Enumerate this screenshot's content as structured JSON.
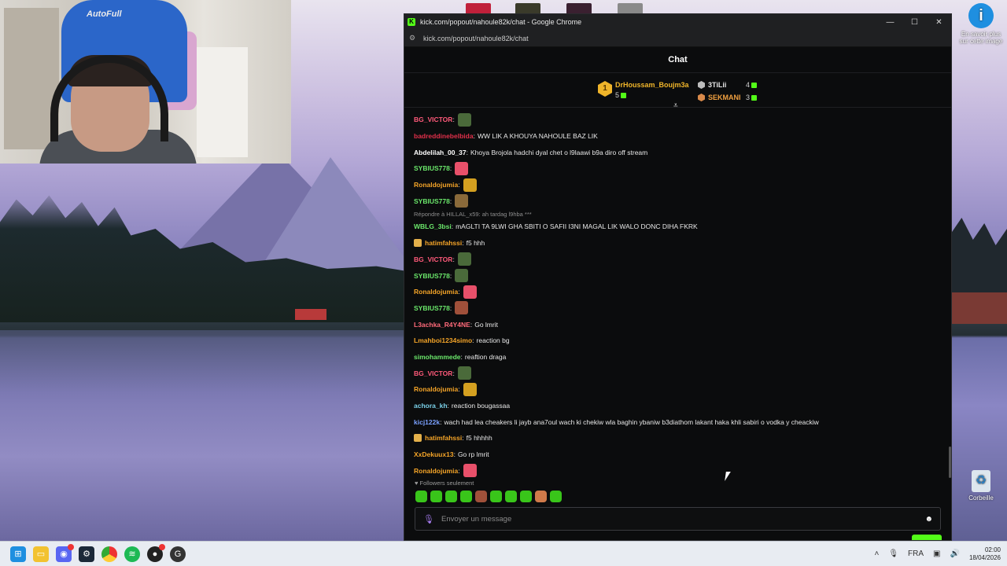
{
  "window": {
    "title": "kick.com/popout/nahoule82k/chat - Google Chrome",
    "url": "kick.com/popout/nahoule82k/chat"
  },
  "chat": {
    "header": "Chat",
    "top_gifters": [
      {
        "rank": "1",
        "name": "DrHoussam_Boujm3a",
        "count": "5"
      },
      {
        "name": "3TiLii",
        "count": "4"
      },
      {
        "name": "SEKMANI",
        "count": "3"
      }
    ],
    "messages": [
      {
        "user": "BG_VICTOR",
        "user_color": "#ff5a7a",
        "text": "",
        "emote_color": "#4a6a3a"
      },
      {
        "user": "badreddinebelbida",
        "user_color": "#e0304a",
        "text": "WW LIK A KHOUYA NAHOULE BAZ LIK"
      },
      {
        "user": "Abdelilah_00_37",
        "user_color": "#ffffff",
        "text": "Khoya Brojola hadchi dyal chet o l9laawi b9a diro off stream"
      },
      {
        "user": "SYBIUS778",
        "user_color": "#6be86b",
        "text": "",
        "emote_color": "#e8506a"
      },
      {
        "user": "Ronaldojumia",
        "user_color": "#f4a428",
        "text": "",
        "emote_color": "#d4a020"
      },
      {
        "user": "SYBIUS778",
        "user_color": "#6be86b",
        "text": "",
        "emote_color": "#8a6a3a"
      },
      {
        "user": "WBLG_3bsi",
        "user_color": "#6be86b",
        "text": "mAGLTI TA 9LWI GHA SBITI O SAFII I3NI MAGAL LIK WALO DONC DIHA FKRK",
        "reply": "Répondre à HILLAL_x59: ah tardag l9hba ***"
      },
      {
        "user": "hatimfahssi",
        "user_color": "#f4a428",
        "text": "f5 hhh",
        "badge": true
      },
      {
        "user": "BG_VICTOR",
        "user_color": "#ff5a7a",
        "text": "",
        "emote_color": "#4a6a3a"
      },
      {
        "user": "SYBIUS778",
        "user_color": "#6be86b",
        "text": "",
        "emote_color": "#4a6a3a"
      },
      {
        "user": "Ronaldojumia",
        "user_color": "#f4a428",
        "text": "",
        "emote_color": "#e8506a"
      },
      {
        "user": "SYBIUS778",
        "user_color": "#6be86b",
        "text": "",
        "emote_color": "#a0503a"
      },
      {
        "user": "L3achka_R4Y4NE",
        "user_color": "#ff6a7a",
        "text": "Go lmrit"
      },
      {
        "user": "Lmahboi1234simo",
        "user_color": "#f4a428",
        "text": "reaction bg"
      },
      {
        "user": "simohammede",
        "user_color": "#6be86b",
        "text": "reaftion draga"
      },
      {
        "user": "BG_VICTOR",
        "user_color": "#ff5a7a",
        "text": "",
        "emote_color": "#4a6a3a"
      },
      {
        "user": "Ronaldojumia",
        "user_color": "#f4a428",
        "text": "",
        "emote_color": "#d4a020"
      },
      {
        "user": "achora_kh",
        "user_color": "#7ad0e8",
        "text": "reaction bougassaa"
      },
      {
        "user": "kicj122k",
        "user_color": "#7aa0ff",
        "text": "wach had lea cheakers li jayb ana7oul wach ki chekiw wla baghin ybaniw b3diathom lakant haka khli sabiri o vodka y cheackiw"
      },
      {
        "user": "hatimfahssi",
        "user_color": "#f4a428",
        "text": "f5 hhhhh",
        "badge": true
      },
      {
        "user": "XxDekuux13",
        "user_color": "#f4a428",
        "text": "Go rp lmrit"
      },
      {
        "user": "Ronaldojumia",
        "user_color": "#f4a428",
        "text": "",
        "emote_color": "#e8506a"
      }
    ],
    "followers_only": "Followers seulement",
    "input_placeholder": "Envoyer un message"
  },
  "desktop": {
    "icons": [
      {
        "name": "info",
        "label": "En savoir plus sur cette image"
      },
      {
        "name": "recycle-bin",
        "label": "Corbeille"
      }
    ],
    "webcam_chair_text": "AutoFull"
  },
  "taskbar": {
    "language": "FRA",
    "time": "02:00",
    "date": "18/04/2026"
  },
  "colors": {
    "kick_green": "#53fc18",
    "gold": "#f0b52a"
  }
}
